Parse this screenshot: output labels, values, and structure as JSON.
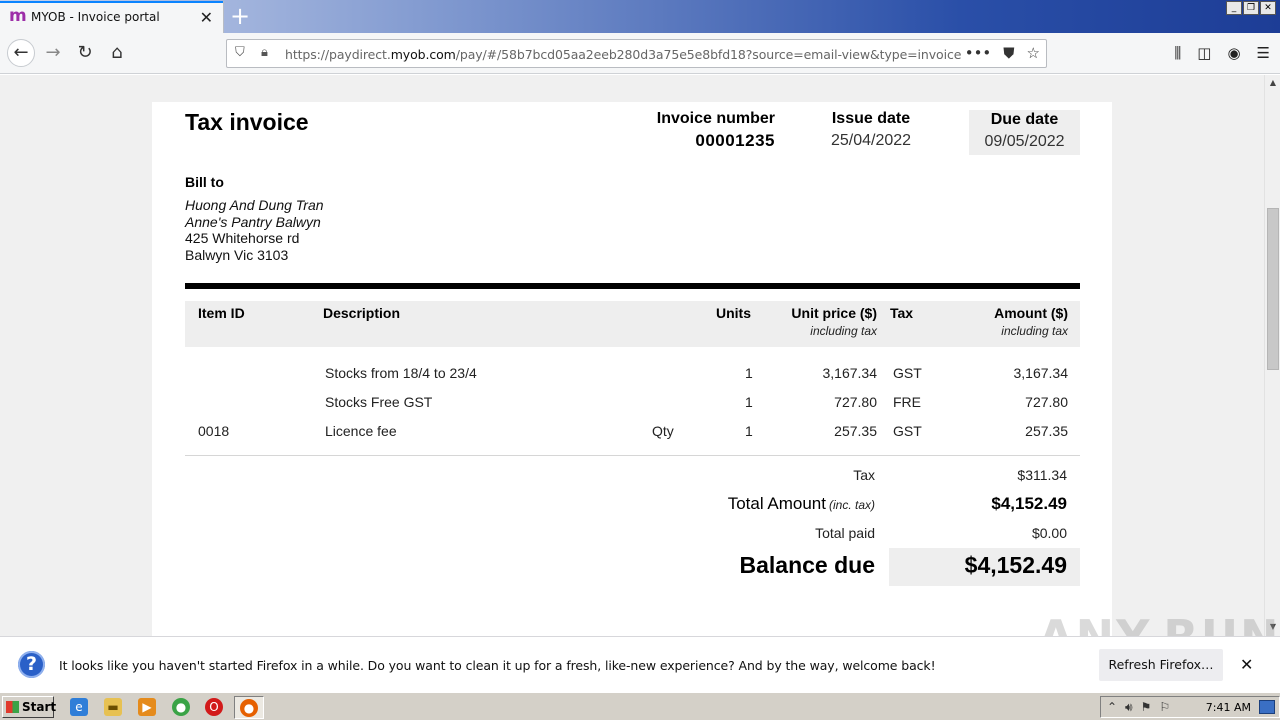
{
  "browser": {
    "tab_title": "MYOB - Invoice portal",
    "tab_favicon": "m",
    "url_prefix": "https://paydirect.",
    "url_domain": "myob.com",
    "url_suffix": "/pay/#/58b7bcd05aa2eeb280d3a75e5e8bfd18?source=email-view&type=invoice",
    "accent_color": "#0a84ff",
    "icons": [
      "back-icon",
      "forward-icon",
      "reload-icon",
      "home-icon",
      "shield-icon",
      "lock-icon",
      "more-icon",
      "pocket-icon",
      "bookmark-star-icon",
      "library-icon",
      "sidebar-icon",
      "account-icon",
      "menu-icon"
    ]
  },
  "invoice": {
    "title": "Tax invoice",
    "invoice_number_label": "Invoice number",
    "invoice_number": "00001235",
    "issue_date_label": "Issue date",
    "issue_date": "25/04/2022",
    "due_date_label": "Due date",
    "due_date": "09/05/2022",
    "bill_to_label": "Bill to",
    "bill_to": {
      "name": "Huong And Dung Tran",
      "company": "Anne's Pantry Balwyn",
      "address1": "425 Whitehorse rd",
      "address2": "Balwyn Vic 3103"
    },
    "columns": {
      "item_id": "Item ID",
      "description": "Description",
      "units": "Units",
      "unit_price": "Unit price ($)",
      "unit_price_sub": "including tax",
      "tax": "Tax",
      "amount": "Amount ($)",
      "amount_sub": "including tax"
    },
    "lines": [
      {
        "item_id": "",
        "description": "Stocks from 18/4 to 23/4",
        "unit_type": "",
        "units": "1",
        "unit_price": "3,167.34",
        "tax": "GST",
        "amount": "3,167.34"
      },
      {
        "item_id": "",
        "description": "Stocks Free GST",
        "unit_type": "",
        "units": "1",
        "unit_price": "727.80",
        "tax": "FRE",
        "amount": "727.80"
      },
      {
        "item_id": "0018",
        "description": "Licence fee",
        "unit_type": "Qty",
        "units": "1",
        "unit_price": "257.35",
        "tax": "GST",
        "amount": "257.35"
      }
    ],
    "totals": {
      "tax_label": "Tax",
      "tax": "$311.34",
      "total_label": "Total Amount",
      "total_sub": "(inc. tax)",
      "total": "$4,152.49",
      "paid_label": "Total paid",
      "paid": "$0.00",
      "balance_label": "Balance due",
      "balance": "$4,152.49"
    }
  },
  "notification": {
    "text": "It looks like you haven't started Firefox in a while. Do you want to clean it up for a fresh, like-new experience? And by the way, welcome back!",
    "button": "Refresh Firefox…"
  },
  "watermark": "ANY.RUN",
  "taskbar": {
    "start_label": "Start",
    "clock": "7:41 AM"
  }
}
